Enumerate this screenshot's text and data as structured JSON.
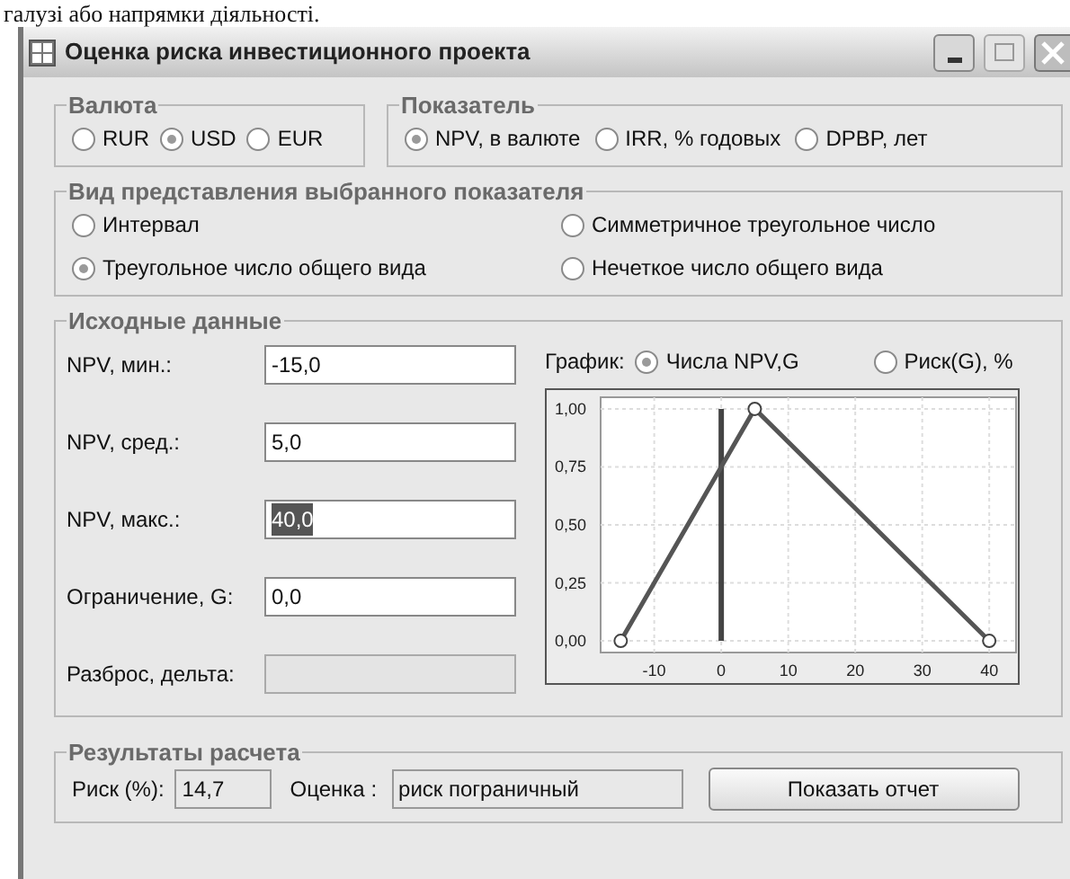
{
  "caption_text": "галузі або напрямки діяльності.",
  "window": {
    "title": "Оценка риска инвестиционного проекта"
  },
  "currency": {
    "title": "Валюта",
    "options": [
      {
        "label": "RUR",
        "selected": false
      },
      {
        "label": "USD",
        "selected": true
      },
      {
        "label": "EUR",
        "selected": false
      }
    ]
  },
  "indicator": {
    "title": "Показатель",
    "options": [
      {
        "label": "NPV, в валюте",
        "selected": true
      },
      {
        "label": "IRR, % годовых",
        "selected": false
      },
      {
        "label": "DPBP, лет",
        "selected": false
      }
    ]
  },
  "representation": {
    "title": "Вид представления выбранного показателя",
    "options": [
      {
        "label": "Интервал",
        "selected": false
      },
      {
        "label": "Симметричное треугольное число",
        "selected": false
      },
      {
        "label": "Треугольное число общего вида",
        "selected": true
      },
      {
        "label": "Нечеткое число общего вида",
        "selected": false
      }
    ]
  },
  "input": {
    "title": "Исходные данные",
    "fields": [
      {
        "label": "NPV, мин.:",
        "value": "-15,0",
        "highlighted": false,
        "disabled": false
      },
      {
        "label": "NPV, сред.:",
        "value": "5,0",
        "highlighted": false,
        "disabled": false
      },
      {
        "label": "NPV, макс.:",
        "value": "40,0",
        "highlighted": true,
        "disabled": false
      },
      {
        "label": "Ограничение, G:",
        "value": "0,0",
        "highlighted": false,
        "disabled": false
      },
      {
        "label": "Разброс, дельта:",
        "disabled": true
      }
    ],
    "chart_mode": {
      "label": "График:",
      "options": [
        {
          "label": "Числа NPV,G",
          "selected": true
        },
        {
          "label": "Риск(G), %",
          "selected": false
        }
      ]
    },
    "chart_data": {
      "type": "line",
      "x": [
        -15,
        5,
        40
      ],
      "series": [
        {
          "color": "#555555",
          "marker": "circle",
          "values": [
            0,
            1,
            0
          ]
        }
      ],
      "xlim": [
        -18,
        44
      ],
      "ylim": [
        -0.05,
        1.05
      ],
      "grid": true,
      "xticks": [
        -10,
        0,
        10,
        20,
        30,
        40
      ],
      "yticks": [
        {
          "value": 0,
          "label": "0,00"
        },
        {
          "value": 0.25,
          "label": "0,25"
        },
        {
          "value": 0.5,
          "label": "0,50"
        },
        {
          "value": 0.75,
          "label": "0,75"
        },
        {
          "value": 1,
          "label": "1,00"
        }
      ],
      "ref_lines": [
        {
          "axis": "x",
          "value": 0
        }
      ]
    }
  },
  "results": {
    "title": "Результаты расчета",
    "risk_label": "Риск (%):",
    "risk_value": "14,7",
    "assessment_label": "Оценка :",
    "assessment_value": "риск пограничный",
    "report_button": "Показать отчет"
  }
}
